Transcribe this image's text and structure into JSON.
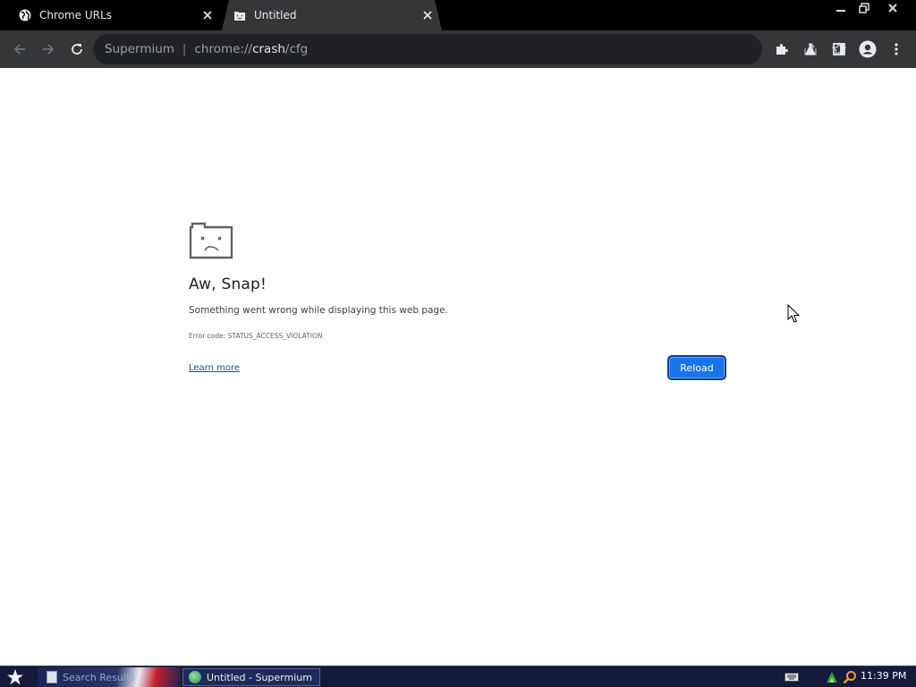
{
  "tabs": [
    {
      "title": "Chrome URLs",
      "icon": "globe-icon",
      "active": false
    },
    {
      "title": "Untitled",
      "icon": "sad-tab-icon",
      "active": true
    }
  ],
  "omnibox": {
    "site_label": "Supermium",
    "url_scheme": "chrome://",
    "url_host": "crash",
    "url_path": "/cfg"
  },
  "error_page": {
    "heading": "Aw, Snap!",
    "message": "Something went wrong while displaying this web page.",
    "error_code": "Error code: STATUS_ACCESS_VIOLATION",
    "learn_more": "Learn more",
    "reload_button": "Reload"
  },
  "taskbar": {
    "items": [
      {
        "label": "Search Results",
        "icon": "document-icon"
      },
      {
        "label": "Untitled - Supermium",
        "icon": "browser-icon"
      }
    ],
    "clock": "11:39 PM"
  },
  "colors": {
    "tabstrip_bg": "#000000",
    "toolbar_bg": "#353638",
    "omnibox_bg": "#202124",
    "accent_blue": "#1a73e8",
    "taskbar_bg": "#131a3a"
  }
}
